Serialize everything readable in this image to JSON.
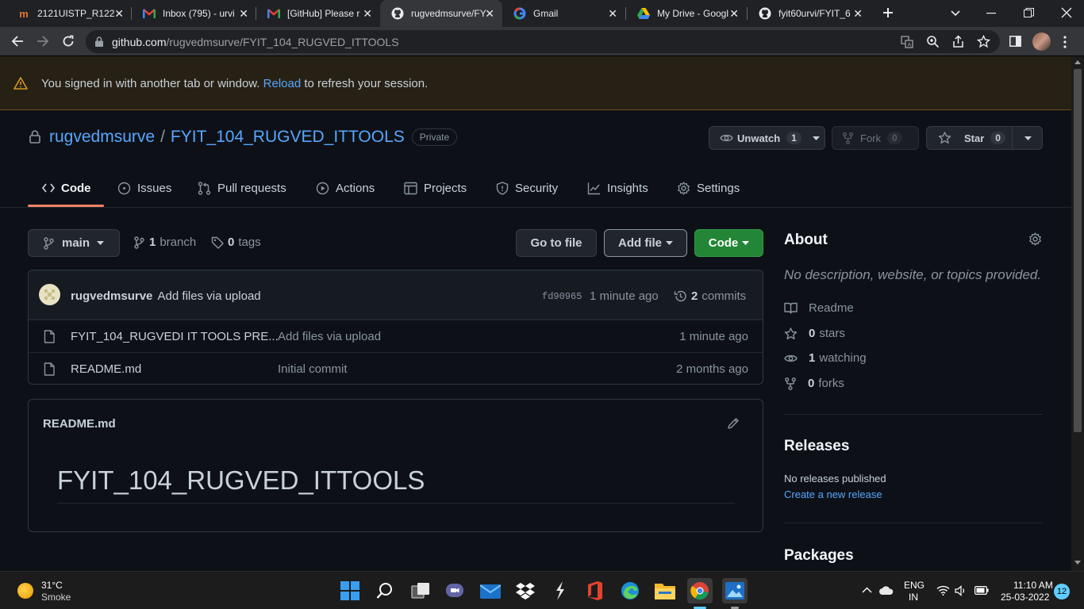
{
  "browser": {
    "tabs": [
      {
        "title": "2121UISTP_R122",
        "active": false
      },
      {
        "title": "Inbox (795) - urvi",
        "active": false
      },
      {
        "title": "[GitHub] Please r",
        "active": false
      },
      {
        "title": "rugvedmsurve/FY",
        "active": true
      },
      {
        "title": "Gmail",
        "active": false
      },
      {
        "title": "My Drive - Googl",
        "active": false
      },
      {
        "title": "fyit60urvi/FYIT_6",
        "active": false
      }
    ],
    "url_host": "github.com",
    "url_path": "/rugvedmsurve/FYIT_104_RUGVED_ITTOOLS"
  },
  "banner": {
    "text_before": "You signed in with another tab or window.",
    "link": "Reload",
    "text_after": "to refresh your session."
  },
  "repo": {
    "owner": "rugvedmsurve",
    "separator": "/",
    "name": "FYIT_104_RUGVED_ITTOOLS",
    "visibility": "Private",
    "unwatch_label": "Unwatch",
    "watch_count": "1",
    "fork_label": "Fork",
    "fork_count": "0",
    "star_label": "Star",
    "star_count": "0"
  },
  "nav": {
    "code": "Code",
    "issues": "Issues",
    "pulls": "Pull requests",
    "actions": "Actions",
    "projects": "Projects",
    "security": "Security",
    "insights": "Insights",
    "settings": "Settings"
  },
  "branchbar": {
    "branch": "main",
    "branch_count": "1",
    "branch_label": "branch",
    "tag_count": "0",
    "tag_label": "tags",
    "go_to_file": "Go to file",
    "add_file": "Add file",
    "code": "Code"
  },
  "commit": {
    "author": "rugvedmsurve",
    "message": "Add files via upload",
    "sha": "fd90965",
    "age": "1 minute ago",
    "count": "2",
    "count_label": "commits"
  },
  "files": [
    {
      "name": "FYIT_104_RUGVEDI IT TOOLS PRE...",
      "message": "Add files via upload",
      "age": "1 minute ago"
    },
    {
      "name": "README.md",
      "message": "Initial commit",
      "age": "2 months ago"
    }
  ],
  "readme": {
    "filename": "README.md",
    "heading": "FYIT_104_RUGVED_ITTOOLS"
  },
  "about": {
    "title": "About",
    "description": "No description, website, or topics provided.",
    "readme": "Readme",
    "stars_count": "0",
    "stars_label": "stars",
    "watching_count": "1",
    "watching_label": "watching",
    "forks_count": "0",
    "forks_label": "forks"
  },
  "releases": {
    "title": "Releases",
    "none_text": "No releases published",
    "create_link": "Create a new release"
  },
  "packages": {
    "title": "Packages"
  },
  "taskbar": {
    "temperature": "31°C",
    "weather": "Smoke",
    "lang": "ENG",
    "region": "IN",
    "time": "11:10 AM",
    "date": "25-03-2022",
    "notifications": "12"
  },
  "colors": {
    "link": "#58a6ff",
    "success": "#238636",
    "nav_underline": "#f78166",
    "warning_bg": "#272115"
  }
}
